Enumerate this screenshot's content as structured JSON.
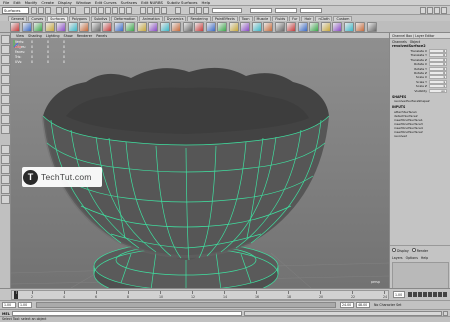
{
  "menubar": {
    "items": [
      "File",
      "Edit",
      "Modify",
      "Create",
      "Display",
      "Window",
      "Edit Curves",
      "Surfaces",
      "Edit NURBS",
      "Subdiv Surfaces",
      "Help"
    ]
  },
  "statusline": {
    "mode": "Surfaces"
  },
  "shelf": {
    "tabs": [
      "General",
      "Curves",
      "Surfaces",
      "Polygons",
      "Subdivs",
      "Deformation",
      "Animation",
      "Dynamics",
      "Rendering",
      "PaintEffects",
      "Toon",
      "Muscle",
      "Fluids",
      "Fur",
      "Hair",
      "nCloth",
      "Custom"
    ],
    "active_tab": "Surfaces"
  },
  "viewport": {
    "menu": [
      "View",
      "Shading",
      "Lighting",
      "Show",
      "Renderer",
      "Panels"
    ],
    "hud": [
      {
        "label": "Verts:",
        "a": "0",
        "b": "0",
        "c": "0"
      },
      {
        "label": "Edges:",
        "a": "0",
        "b": "0",
        "c": "0"
      },
      {
        "label": "Faces:",
        "a": "0",
        "b": "0",
        "c": "0"
      },
      {
        "label": "Tris:",
        "a": "0",
        "b": "0",
        "c": "0"
      },
      {
        "label": "UVs:",
        "a": "0",
        "b": "0",
        "c": "0"
      }
    ],
    "camera": "persp",
    "wire_color": "#3fe0a0",
    "shade_color": "#4a4a4a"
  },
  "watermark": {
    "logo": "T",
    "text": "TechTut.com"
  },
  "channelbox": {
    "title": "Channel Box / Layer Editor",
    "menu": [
      "Channels",
      "Object"
    ],
    "node": "revolvedSurface2",
    "attributes": [
      {
        "name": "Translate X",
        "value": "0"
      },
      {
        "name": "Translate Y",
        "value": "0"
      },
      {
        "name": "Translate Z",
        "value": "0"
      },
      {
        "name": "Rotate X",
        "value": "0"
      },
      {
        "name": "Rotate Y",
        "value": "0"
      },
      {
        "name": "Rotate Z",
        "value": "0"
      },
      {
        "name": "Scale X",
        "value": "1"
      },
      {
        "name": "Scale Y",
        "value": "1"
      },
      {
        "name": "Scale Z",
        "value": "1"
      },
      {
        "name": "Visibility",
        "value": "on"
      }
    ],
    "shapes_label": "SHAPES",
    "shape": "revolvedSurfaceShape2",
    "inputs_label": "INPUTS",
    "inputs": [
      "attachSurface1",
      "detachSurface2",
      "insertKnotSurface1",
      "insertKnotSurface3",
      "insertKnotSurface4",
      "insertKnotSurface2",
      "revolve2"
    ],
    "layer": {
      "tabs": [
        "Display",
        "Render"
      ],
      "menu": [
        "Layers",
        "Options",
        "Help"
      ]
    }
  },
  "timeslider": {
    "ticks": [
      "1",
      "2",
      "4",
      "6",
      "8",
      "10",
      "12",
      "14",
      "16",
      "18",
      "20",
      "22",
      "24"
    ],
    "current_frame": "1.00"
  },
  "rangebar": {
    "start": "1.00",
    "inner_start": "1.00",
    "inner_end": "24.00",
    "end": "48.00",
    "character_set": "No Character Set"
  },
  "commandline": {
    "label": "MEL"
  },
  "helpline": {
    "text": "Select Tool: select an object"
  }
}
